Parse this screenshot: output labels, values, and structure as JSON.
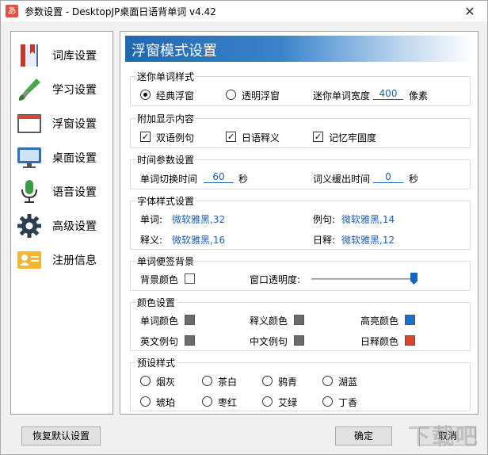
{
  "window": {
    "title": "参数设置 - DesktopJP桌面日语背单词 v4.42",
    "app_icon": "あ",
    "close_glyph": "✕"
  },
  "sidebar": {
    "items": [
      {
        "label": "词库设置",
        "icon": "book-icon"
      },
      {
        "label": "学习设置",
        "icon": "brush-icon"
      },
      {
        "label": "浮窗设置",
        "icon": "window-icon"
      },
      {
        "label": "桌面设置",
        "icon": "monitor-icon"
      },
      {
        "label": "语音设置",
        "icon": "microphone-icon"
      },
      {
        "label": "高级设置",
        "icon": "gear-icon"
      },
      {
        "label": "注册信息",
        "icon": "id-card-icon"
      }
    ]
  },
  "panel": {
    "title": "浮窗模式设置",
    "mini_style": {
      "legend": "迷你单词样式",
      "option_classic": "经典浮窗",
      "option_transparent": "透明浮窗",
      "selected": "经典浮窗",
      "width_label": "迷你单词宽度",
      "width_value": "400",
      "width_unit": "像素"
    },
    "extra_display": {
      "legend": "附加显示内容",
      "bilingual": "双语例句",
      "japanese_def": "日语释义",
      "memory": "记忆牢固度",
      "checked_mark": "✓"
    },
    "time_params": {
      "legend": "时间参数设置",
      "switch_label": "单词切换时间",
      "switch_value": "60",
      "switch_unit": "秒",
      "delay_label": "词义缓出时间",
      "delay_value": "0",
      "delay_unit": "秒"
    },
    "font_style": {
      "legend": "字体样式设置",
      "word_label": "单词:",
      "word_font": "微软雅黑,32",
      "example_label": "例句:",
      "example_font": "微软雅黑,14",
      "meaning_label": "释义:",
      "meaning_font": "微软雅黑,16",
      "jp_def_label": "日释:",
      "jp_def_font": "微软雅黑,12"
    },
    "sticky_bg": {
      "legend": "单词便签背景",
      "bg_color_label": "背景颜色",
      "opacity_label": "窗口透明度:",
      "opacity_level": 1.0
    },
    "colors": {
      "legend": "颜色设置",
      "word_color": {
        "label": "单词颜色",
        "color": "#6b6b6b"
      },
      "meaning_color": {
        "label": "释义颜色",
        "color": "#6b6b6b"
      },
      "highlight_color": {
        "label": "高亮颜色",
        "color": "#1a6fc9"
      },
      "en_example_color": {
        "label": "英文例句",
        "color": "#6b6b6b"
      },
      "cn_example_color": {
        "label": "中文例句",
        "color": "#6b6b6b"
      },
      "jp_def_color": {
        "label": "日释颜色",
        "color": "#d9452b"
      }
    },
    "presets": {
      "legend": "预设样式",
      "options": [
        "烟灰",
        "茶白",
        "鸦青",
        "湖蓝",
        "琥珀",
        "枣红",
        "艾绿",
        "丁香"
      ]
    }
  },
  "buttons": {
    "restore": "恢复默认设置",
    "ok": "确定",
    "cancel": "取消"
  },
  "watermark": "下载吧"
}
